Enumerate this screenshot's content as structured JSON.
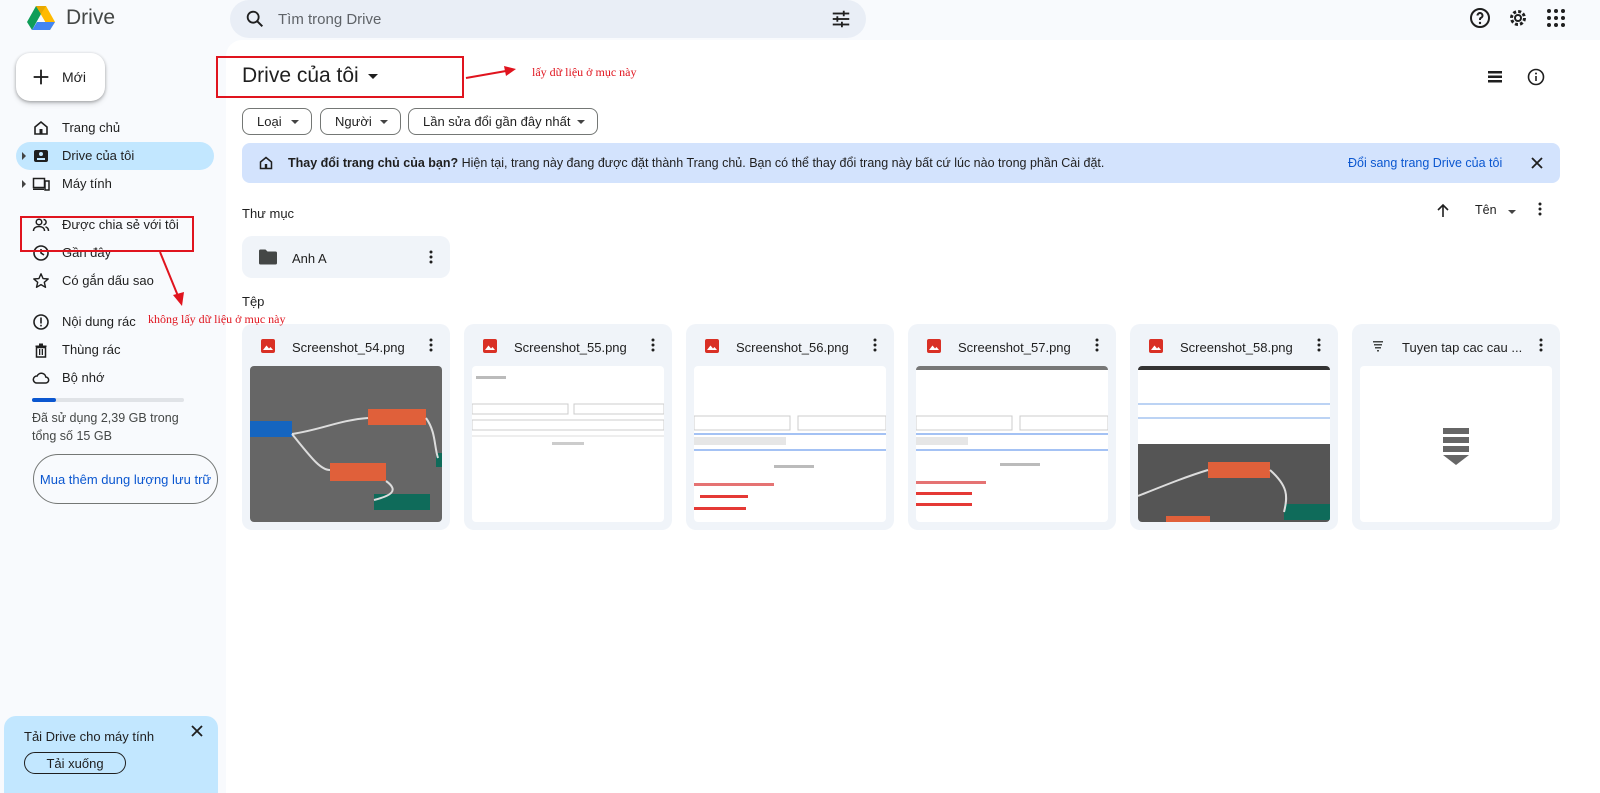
{
  "app": {
    "name": "Drive"
  },
  "search": {
    "placeholder": "Tìm trong Drive"
  },
  "sidebar": {
    "new_label": "Mới",
    "items": [
      {
        "label": "Trang chủ"
      },
      {
        "label": "Drive của tôi"
      },
      {
        "label": "Máy tính"
      },
      {
        "label": "Được chia sẻ với tôi"
      },
      {
        "label": "Gần đây"
      },
      {
        "label": "Có gắn dấu sao"
      },
      {
        "label": "Nội dung rác"
      },
      {
        "label": "Thùng rác"
      },
      {
        "label": "Bộ nhớ"
      }
    ],
    "storage": {
      "used_fraction": 0.16,
      "text": "Đã sử dụng 2,39 GB trong tổng số 15 GB"
    },
    "buy_storage_label": "Mua thêm dung lượng lưu trữ",
    "promo": {
      "title": "Tải Drive cho máy tính",
      "button": "Tải xuống"
    }
  },
  "main": {
    "title": "Drive của tôi",
    "filters": [
      "Loại",
      "Người",
      "Lần sửa đổi gần đây nhất"
    ],
    "banner": {
      "bold": "Thay đổi trang chủ của bạn?",
      "text": " Hiện tại, trang này đang được đặt thành Trang chủ. Bạn có thể thay đổi trang này bất cứ lúc nào trong phần Cài đặt.",
      "link": "Đổi sang trang Drive của tôi"
    },
    "folders_label": "Thư mục",
    "sort_label": "Tên",
    "folders": [
      {
        "name": "Anh A"
      }
    ],
    "files_label": "Tệp",
    "files": [
      {
        "name": "Screenshot_54.png"
      },
      {
        "name": "Screenshot_55.png"
      },
      {
        "name": "Screenshot_56.png"
      },
      {
        "name": "Screenshot_57.png"
      },
      {
        "name": "Screenshot_58.png"
      },
      {
        "name": "Tuyen tap cac cau ..."
      }
    ]
  },
  "annotations": {
    "top": "lấy dữ liệu ở mục này",
    "side": "không lấy dữ liệu ở mục này"
  },
  "colors": {
    "accent": "#0b57d0",
    "active_nav": "#c2e7ff",
    "annotation": "#e0141e",
    "image_icon": "#d93025"
  }
}
